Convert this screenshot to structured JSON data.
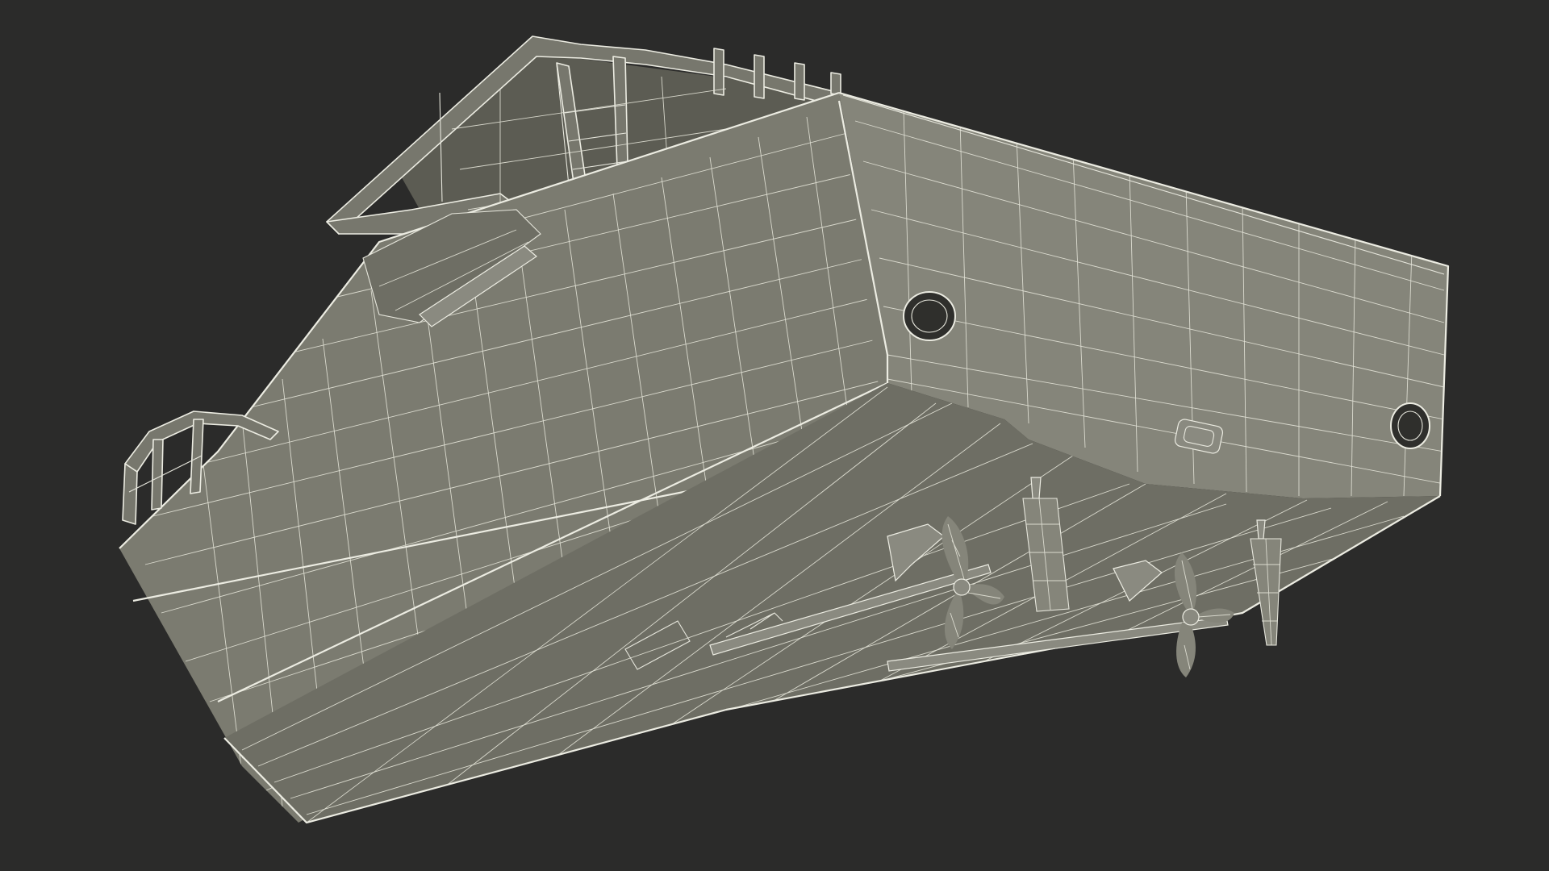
{
  "viewport": {
    "background_color": "#2b2b2a",
    "wireframe_color": "#ecece2",
    "surface_color": "#7b7b70"
  },
  "model": {
    "parts": [
      "hull-bottom",
      "hull-side",
      "transom",
      "cabin-roof-frame",
      "bow-rail",
      "exhaust-port-left",
      "exhaust-port-right",
      "transom-vent",
      "propeller-left",
      "propeller-right",
      "rudder-left",
      "rudder-right",
      "prop-shaft-left",
      "prop-shaft-right"
    ]
  }
}
